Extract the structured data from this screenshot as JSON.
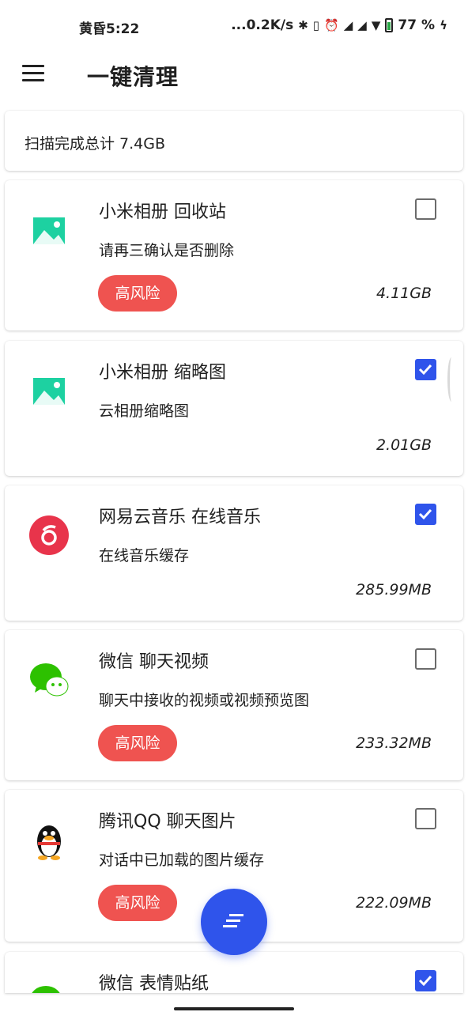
{
  "status_bar": {
    "time": "黄昏5:22",
    "network_speed": "...0.2K/s",
    "battery_percent": "77",
    "percent_sign": "%"
  },
  "app_bar": {
    "title": "一键清理",
    "menu_icon": "hamburger-menu-icon"
  },
  "summary": {
    "text": "扫描完成总计 7.4GB"
  },
  "items": [
    {
      "title": "小米相册 回收站",
      "desc": "请再三确认是否删除",
      "size": "4.11GB",
      "risk": "高风险",
      "checked": false,
      "icon": "gallery-icon",
      "icon_color": "#1dd1a1"
    },
    {
      "title": "小米相册 缩略图",
      "desc": "云相册缩略图",
      "size": "2.01GB",
      "risk": "",
      "checked": true,
      "icon": "gallery-icon",
      "icon_color": "#1dd1a1"
    },
    {
      "title": "网易云音乐 在线音乐",
      "desc": "在线音乐缓存",
      "size": "285.99MB",
      "risk": "",
      "checked": true,
      "icon": "netease-music-icon",
      "icon_color": "#e8344b"
    },
    {
      "title": "微信 聊天视频",
      "desc": "聊天中接收的视频或视频预览图",
      "size": "233.32MB",
      "risk": "高风险",
      "checked": false,
      "icon": "wechat-icon",
      "icon_color": "#2dc100"
    },
    {
      "title": "腾讯QQ 聊天图片",
      "desc": "对话中已加载的图片缓存",
      "size": "222.09MB",
      "risk": "高风险",
      "checked": false,
      "icon": "qq-penguin-icon",
      "icon_color": "#111111"
    },
    {
      "title": "微信 表情贴纸",
      "desc": "",
      "size": "",
      "risk": "",
      "checked": true,
      "icon": "wechat-icon",
      "icon_color": "#2dc100"
    }
  ],
  "fab": {
    "icon": "sort-lines-icon"
  },
  "colors": {
    "accent": "#2f54eb",
    "risk": "#ef5350"
  }
}
